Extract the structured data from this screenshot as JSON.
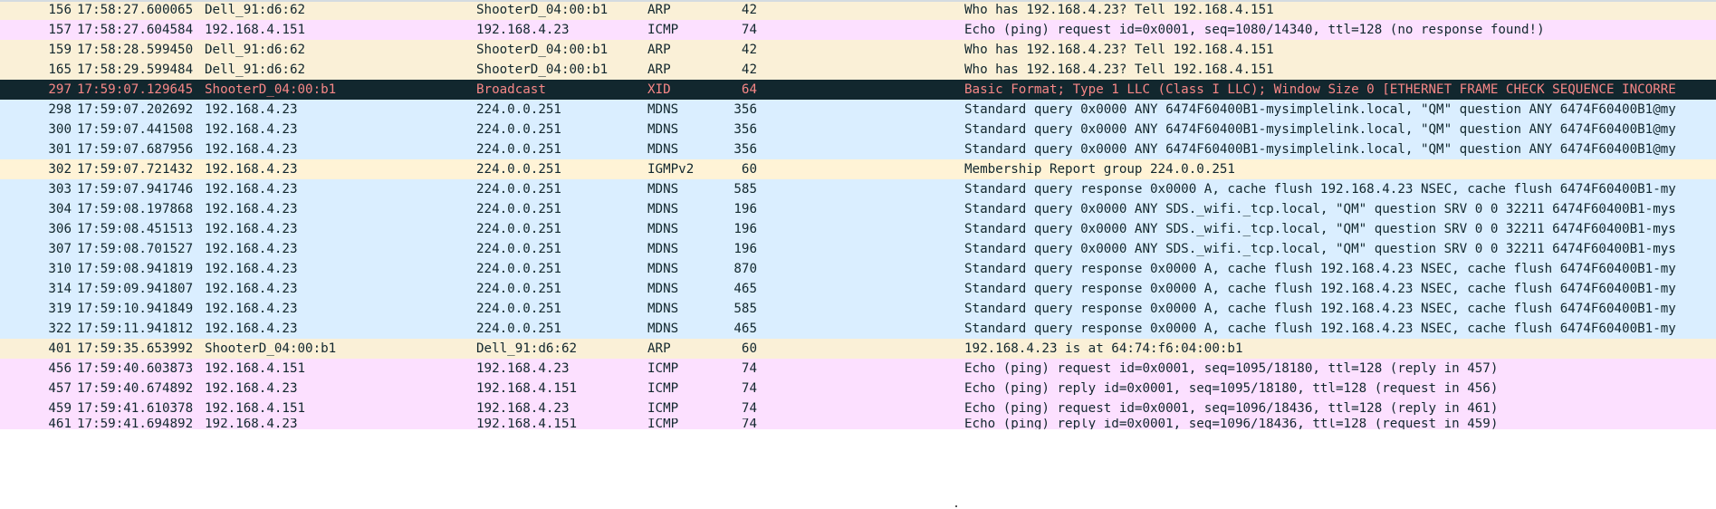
{
  "packets": [
    {
      "no": "156",
      "time": "17:58:27.600065",
      "source": "Dell_91:d6:62",
      "destination": "ShooterD_04:00:b1",
      "protocol": "ARP",
      "length": "42",
      "info": "Who has 192.168.4.23? Tell 192.168.4.151",
      "color": "arp"
    },
    {
      "no": "157",
      "time": "17:58:27.604584",
      "source": "192.168.4.151",
      "destination": "192.168.4.23",
      "protocol": "ICMP",
      "length": "74",
      "info": "Echo (ping) request  id=0x0001, seq=1080/14340, ttl=128 (no response found!)",
      "color": "icmp"
    },
    {
      "no": "159",
      "time": "17:58:28.599450",
      "source": "Dell_91:d6:62",
      "destination": "ShooterD_04:00:b1",
      "protocol": "ARP",
      "length": "42",
      "info": "Who has 192.168.4.23? Tell 192.168.4.151",
      "color": "arp"
    },
    {
      "no": "165",
      "time": "17:58:29.599484",
      "source": "Dell_91:d6:62",
      "destination": "ShooterD_04:00:b1",
      "protocol": "ARP",
      "length": "42",
      "info": "Who has 192.168.4.23? Tell 192.168.4.151",
      "color": "arp"
    },
    {
      "no": "297",
      "time": "17:59:07.129645",
      "source": "ShooterD_04:00:b1",
      "destination": "Broadcast",
      "protocol": "XID",
      "length": "64",
      "info": "Basic Format; Type 1 LLC (Class I LLC); Window Size 0 [ETHERNET FRAME CHECK SEQUENCE INCORRE",
      "color": "bad"
    },
    {
      "no": "298",
      "time": "17:59:07.202692",
      "source": "192.168.4.23",
      "destination": "224.0.0.251",
      "protocol": "MDNS",
      "length": "356",
      "info": "Standard query 0x0000 ANY 6474F60400B1-mysimplelink.local, \"QM\" question ANY 6474F60400B1@my",
      "color": "mdns"
    },
    {
      "no": "300",
      "time": "17:59:07.441508",
      "source": "192.168.4.23",
      "destination": "224.0.0.251",
      "protocol": "MDNS",
      "length": "356",
      "info": "Standard query 0x0000 ANY 6474F60400B1-mysimplelink.local, \"QM\" question ANY 6474F60400B1@my",
      "color": "mdns"
    },
    {
      "no": "301",
      "time": "17:59:07.687956",
      "source": "192.168.4.23",
      "destination": "224.0.0.251",
      "protocol": "MDNS",
      "length": "356",
      "info": "Standard query 0x0000 ANY 6474F60400B1-mysimplelink.local, \"QM\" question ANY 6474F60400B1@my",
      "color": "mdns"
    },
    {
      "no": "302",
      "time": "17:59:07.721432",
      "source": "192.168.4.23",
      "destination": "224.0.0.251",
      "protocol": "IGMPv2",
      "length": "60",
      "info": "Membership Report group 224.0.0.251",
      "color": "igmp"
    },
    {
      "no": "303",
      "time": "17:59:07.941746",
      "source": "192.168.4.23",
      "destination": "224.0.0.251",
      "protocol": "MDNS",
      "length": "585",
      "info": "Standard query response 0x0000 A, cache flush 192.168.4.23 NSEC, cache flush 6474F60400B1-my",
      "color": "mdns"
    },
    {
      "no": "304",
      "time": "17:59:08.197868",
      "source": "192.168.4.23",
      "destination": "224.0.0.251",
      "protocol": "MDNS",
      "length": "196",
      "info": "Standard query 0x0000 ANY SDS._wifi._tcp.local, \"QM\" question SRV 0 0 32211 6474F60400B1-mys",
      "color": "mdns"
    },
    {
      "no": "306",
      "time": "17:59:08.451513",
      "source": "192.168.4.23",
      "destination": "224.0.0.251",
      "protocol": "MDNS",
      "length": "196",
      "info": "Standard query 0x0000 ANY SDS._wifi._tcp.local, \"QM\" question SRV 0 0 32211 6474F60400B1-mys",
      "color": "mdns"
    },
    {
      "no": "307",
      "time": "17:59:08.701527",
      "source": "192.168.4.23",
      "destination": "224.0.0.251",
      "protocol": "MDNS",
      "length": "196",
      "info": "Standard query 0x0000 ANY SDS._wifi._tcp.local, \"QM\" question SRV 0 0 32211 6474F60400B1-mys",
      "color": "mdns"
    },
    {
      "no": "310",
      "time": "17:59:08.941819",
      "source": "192.168.4.23",
      "destination": "224.0.0.251",
      "protocol": "MDNS",
      "length": "870",
      "info": "Standard query response 0x0000 A, cache flush 192.168.4.23 NSEC, cache flush 6474F60400B1-my",
      "color": "mdns"
    },
    {
      "no": "314",
      "time": "17:59:09.941807",
      "source": "192.168.4.23",
      "destination": "224.0.0.251",
      "protocol": "MDNS",
      "length": "465",
      "info": "Standard query response 0x0000 A, cache flush 192.168.4.23 NSEC, cache flush 6474F60400B1-my",
      "color": "mdns"
    },
    {
      "no": "319",
      "time": "17:59:10.941849",
      "source": "192.168.4.23",
      "destination": "224.0.0.251",
      "protocol": "MDNS",
      "length": "585",
      "info": "Standard query response 0x0000 A, cache flush 192.168.4.23 NSEC, cache flush 6474F60400B1-my",
      "color": "mdns"
    },
    {
      "no": "322",
      "time": "17:59:11.941812",
      "source": "192.168.4.23",
      "destination": "224.0.0.251",
      "protocol": "MDNS",
      "length": "465",
      "info": "Standard query response 0x0000 A, cache flush 192.168.4.23 NSEC, cache flush 6474F60400B1-my",
      "color": "mdns"
    },
    {
      "no": "401",
      "time": "17:59:35.653992",
      "source": "ShooterD_04:00:b1",
      "destination": "Dell_91:d6:62",
      "protocol": "ARP",
      "length": "60",
      "info": "192.168.4.23 is at 64:74:f6:04:00:b1",
      "color": "arp"
    },
    {
      "no": "456",
      "time": "17:59:40.603873",
      "source": "192.168.4.151",
      "destination": "192.168.4.23",
      "protocol": "ICMP",
      "length": "74",
      "info": "Echo (ping) request  id=0x0001, seq=1095/18180, ttl=128 (reply in 457)",
      "color": "icmp"
    },
    {
      "no": "457",
      "time": "17:59:40.674892",
      "source": "192.168.4.23",
      "destination": "192.168.4.151",
      "protocol": "ICMP",
      "length": "74",
      "info": "Echo (ping) reply    id=0x0001, seq=1095/18180, ttl=128 (request in 456)",
      "color": "icmp"
    },
    {
      "no": "459",
      "time": "17:59:41.610378",
      "source": "192.168.4.151",
      "destination": "192.168.4.23",
      "protocol": "ICMP",
      "length": "74",
      "info": "Echo (ping) request  id=0x0001, seq=1096/18436, ttl=128 (reply in 461)",
      "color": "icmp"
    },
    {
      "no": "461",
      "time": "17:59:41.694892",
      "source": "192.168.4.23",
      "destination": "192.168.4.151",
      "protocol": "ICMP",
      "length": "74",
      "info": "Echo (ping) reply    id=0x0001, seq=1096/18436, ttl=128 (request in 459)",
      "color": "icmp"
    }
  ],
  "colors": {
    "arp": "#faf0d7",
    "icmp": "#fce0ff",
    "mdns": "#daeeff",
    "igmp": "#fff3d6",
    "bad_bg": "#12272e",
    "bad_fg": "#f78787"
  }
}
